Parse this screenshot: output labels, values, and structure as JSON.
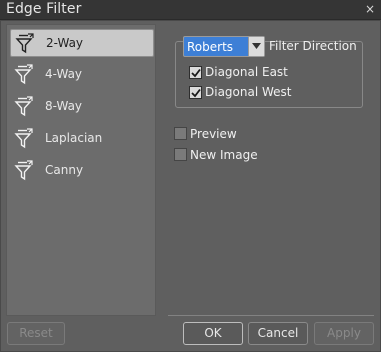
{
  "window": {
    "title": "Edge Filter",
    "close_glyph": "×"
  },
  "filters": {
    "selected": "2-Way",
    "items": [
      {
        "label": "2-Way",
        "icon": "funnel-arrow-icon"
      },
      {
        "label": "4-Way",
        "icon": "funnel-arrow-icon"
      },
      {
        "label": "8-Way",
        "icon": "funnel-arrow-icon"
      },
      {
        "label": "Laplacian",
        "icon": "funnel-arrow-icon"
      },
      {
        "label": "Canny",
        "icon": "funnel-arrow-icon"
      }
    ]
  },
  "direction": {
    "method_value": "Roberts",
    "label": "Filter Direction",
    "diagonal_east": {
      "label": "Diagonal East",
      "checked": true
    },
    "diagonal_west": {
      "label": "Diagonal West",
      "checked": true
    }
  },
  "options": {
    "preview": {
      "label": "Preview",
      "checked": false
    },
    "new_image": {
      "label": "New Image",
      "checked": false
    }
  },
  "buttons": {
    "reset": "Reset",
    "ok": "OK",
    "cancel": "Cancel",
    "apply": "Apply"
  },
  "colors": {
    "selection": "#3d7fd6",
    "background": "#5f5f5f",
    "list_bg": "#6c6c6c",
    "titlebar": "#353535"
  }
}
